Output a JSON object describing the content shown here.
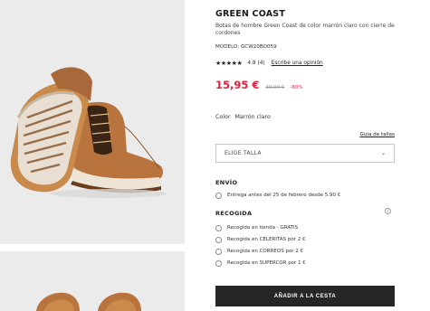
{
  "product": {
    "title": "GREEN COAST",
    "description": "Botas de hombre Green Coast de color marrón claro con cierre de cordones",
    "model": "MODELO: GCW20BO059",
    "stars": "★★★★★",
    "rating_value": 4.8,
    "rating_text": "4.8 (4)",
    "review_link": "Escribe una opinión",
    "price_now": "15,95 €",
    "price_old": "39,90 €",
    "discount": "-60%",
    "color_label": "Color",
    "color_value": "Marrón claro",
    "size_guide": "Guía de tallas",
    "size_placeholder": "ELIGE TALLA"
  },
  "shipping": {
    "title": "ENVÍO",
    "options": [
      "Entrega antes del 25 de febrero desde 5.90 €"
    ]
  },
  "pickup": {
    "title": "RECOGIDA",
    "options": [
      "Recogida en tienda - GRATIS",
      "Recogida en CELERITAS por 2 €",
      "Recogida en CORREOS por 2 €",
      "Recogida en SUPERCOR por 1 €"
    ]
  },
  "cta": {
    "add_to_cart": "AÑADIR A LA CESTA"
  },
  "icons": {
    "select_chevron": "chevron-down-icon",
    "info": "info-icon"
  },
  "colors": {
    "price_red": "#e5203a",
    "button_dark": "#262626",
    "photo_bg": "#ebebeb",
    "boot_leather": "#b8743c"
  }
}
